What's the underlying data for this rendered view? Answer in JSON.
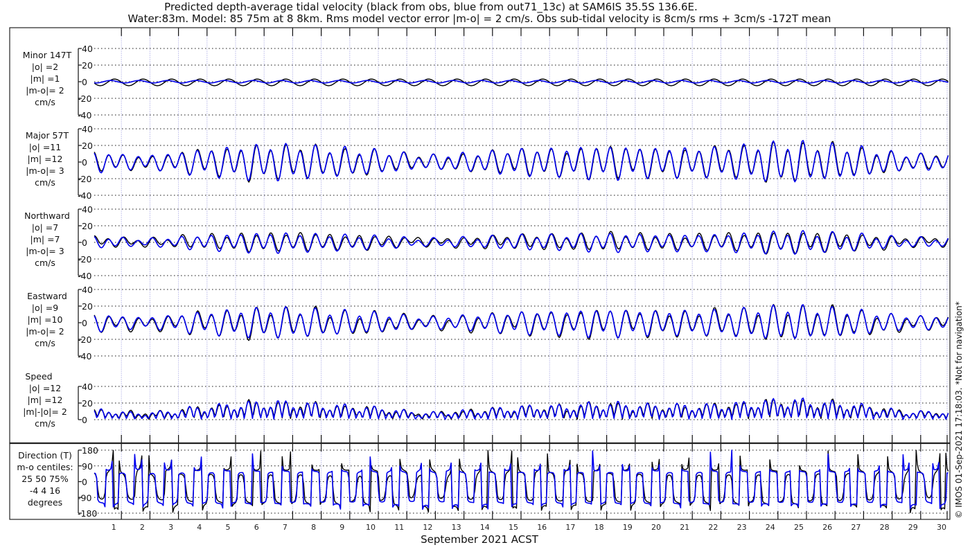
{
  "title": {
    "line1": "Predicted depth-average tidal velocity (black from obs, blue from out71_13c) at SAM6IS 35.5S 136.6E.",
    "line2": "Water:83m. Model: 85 75m at 8 8km. Rms model vector error |m-o| = 2 cm/s. Obs sub-tidal velocity is 8cm/s rms + 3cm/s -172T mean"
  },
  "copyright": "© IMOS 01-Sep-2021 17:18:03. *Not for navigation*",
  "colors": {
    "obs": "#000000",
    "model": "#0000ee",
    "day_grid": "#c9c9ee"
  },
  "chart_data": {
    "type": "line",
    "xlabel": "September 2021 ACST",
    "x_range_days": [
      1,
      31
    ],
    "x_tick_labels": [
      "1",
      "2",
      "3",
      "4",
      "5",
      "6",
      "7",
      "8",
      "9",
      "10",
      "11",
      "12",
      "13",
      "14",
      "15",
      "16",
      "17",
      "18",
      "19",
      "20",
      "21",
      "22",
      "23",
      "24",
      "25",
      "26",
      "27",
      "28",
      "29",
      "30"
    ],
    "series": [
      {
        "name": "obs",
        "color": "black"
      },
      {
        "name": "model out71_13c",
        "color": "blue"
      }
    ],
    "major_axis_deg": 57,
    "minor_axis_deg": 147,
    "major_daily_peak_cm_s": [
      12,
      8,
      10,
      15,
      18,
      21,
      22,
      20,
      18,
      16,
      13,
      8,
      10,
      12,
      15,
      17,
      17,
      20,
      20,
      18,
      18,
      18,
      20,
      23,
      25,
      22,
      20,
      15,
      10,
      10
    ],
    "minor_peak_cm_s": {
      "obs": 4,
      "model": 1.5
    },
    "panels": [
      {
        "id": "minor",
        "lines": [
          "Minor 147T",
          "|o| =2",
          "|m| =1",
          "|m-o|= 2",
          "cm/s"
        ],
        "ylim": [
          -40,
          40
        ],
        "yticks": [
          "40",
          "20",
          "0",
          "-20",
          "-40"
        ]
      },
      {
        "id": "major",
        "lines": [
          "Major 57T",
          "|o| =11",
          "|m| =12",
          "|m-o|= 3",
          "cm/s"
        ],
        "ylim": [
          -40,
          40
        ],
        "yticks": [
          "40",
          "20",
          "0",
          "-20",
          "-40"
        ]
      },
      {
        "id": "north",
        "lines": [
          "Northward",
          "|o| =7",
          "|m| =7",
          "|m-o|= 3",
          "cm/s"
        ],
        "ylim": [
          -40,
          40
        ],
        "yticks": [
          "40",
          "20",
          "0",
          "-20",
          "-40"
        ]
      },
      {
        "id": "east",
        "lines": [
          "Eastward",
          "|o| =9",
          "|m| =10",
          "|m-o|= 2",
          "cm/s"
        ],
        "ylim": [
          -40,
          40
        ],
        "yticks": [
          "40",
          "20",
          "0",
          "-20",
          "-40"
        ]
      },
      {
        "id": "speed",
        "lines": [
          "Speed",
          "|o| =12",
          "|m| =12",
          "|m|-|o|= 2",
          "cm/s"
        ],
        "ylim": [
          0,
          40
        ],
        "yticks": [
          "40",
          "20",
          "0"
        ]
      },
      {
        "id": "direction",
        "lines": [
          "Direction (T)",
          "m-o centiles:",
          "25  50  75%",
          "-4   4  16",
          "degrees"
        ],
        "ylim": [
          -180,
          180
        ],
        "yticks": [
          "180",
          "90",
          "0",
          "-90",
          "-180"
        ]
      }
    ]
  }
}
